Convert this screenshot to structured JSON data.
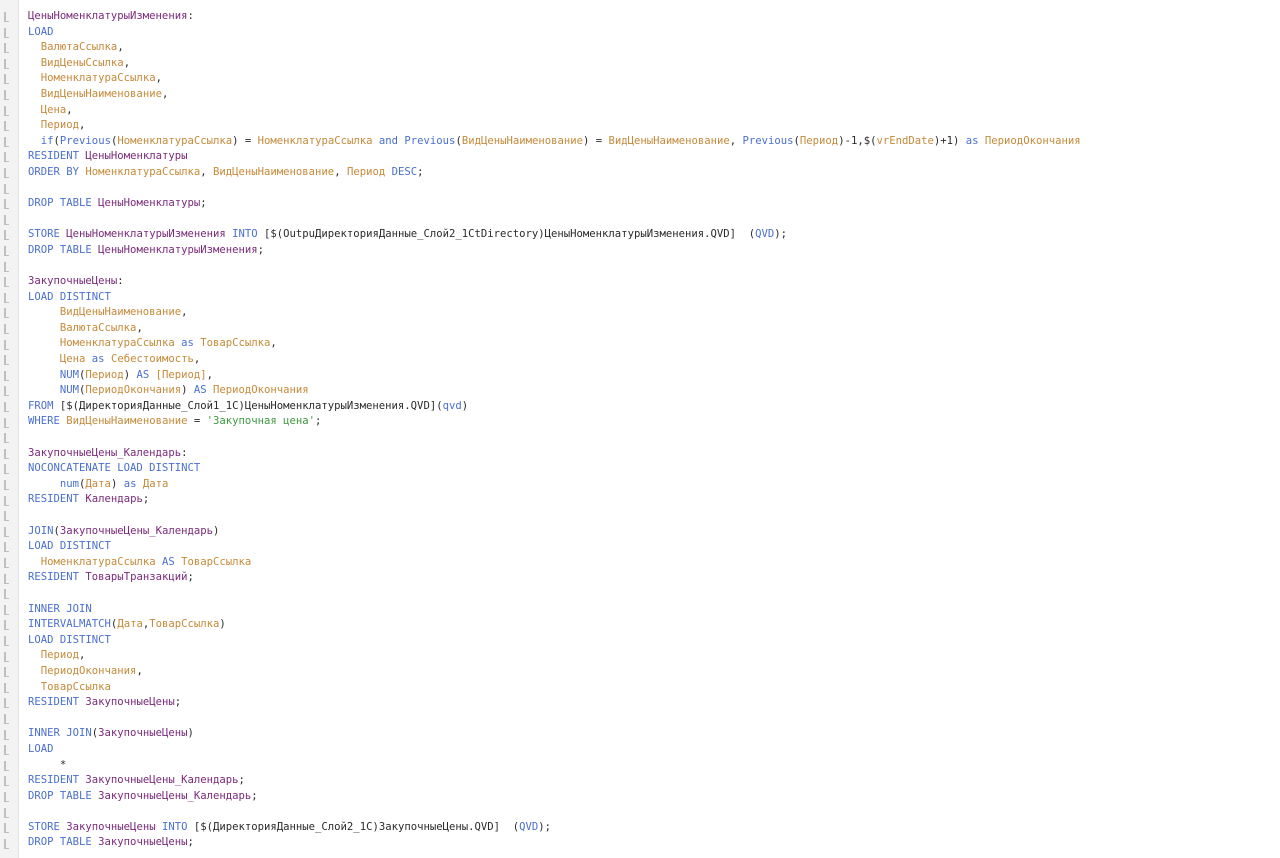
{
  "editor": {
    "lines": [
      [
        {
          "t": "tbl",
          "v": "ЦеныНоменклатурыИзменения"
        },
        {
          "t": "txt",
          "v": ":"
        }
      ],
      [
        {
          "t": "kw",
          "v": "LOAD"
        }
      ],
      [
        {
          "t": "txt",
          "v": "  "
        },
        {
          "t": "fld",
          "v": "ВалютаСсылка"
        },
        {
          "t": "txt",
          "v": ","
        }
      ],
      [
        {
          "t": "txt",
          "v": "  "
        },
        {
          "t": "fld",
          "v": "ВидЦеныСсылка"
        },
        {
          "t": "txt",
          "v": ","
        }
      ],
      [
        {
          "t": "txt",
          "v": "  "
        },
        {
          "t": "fld",
          "v": "НоменклатураСсылка"
        },
        {
          "t": "txt",
          "v": ","
        }
      ],
      [
        {
          "t": "txt",
          "v": "  "
        },
        {
          "t": "fld",
          "v": "ВидЦеныНаименование"
        },
        {
          "t": "txt",
          "v": ","
        }
      ],
      [
        {
          "t": "txt",
          "v": "  "
        },
        {
          "t": "fld",
          "v": "Цена"
        },
        {
          "t": "txt",
          "v": ","
        }
      ],
      [
        {
          "t": "txt",
          "v": "  "
        },
        {
          "t": "fld",
          "v": "Период"
        },
        {
          "t": "txt",
          "v": ","
        }
      ],
      [
        {
          "t": "txt",
          "v": "  "
        },
        {
          "t": "kw",
          "v": "if"
        },
        {
          "t": "txt",
          "v": "("
        },
        {
          "t": "kw",
          "v": "Previous"
        },
        {
          "t": "txt",
          "v": "("
        },
        {
          "t": "fld",
          "v": "НоменклатураСсылка"
        },
        {
          "t": "txt",
          "v": ") = "
        },
        {
          "t": "fld",
          "v": "НоменклатураСсылка"
        },
        {
          "t": "txt",
          "v": " "
        },
        {
          "t": "kw",
          "v": "and"
        },
        {
          "t": "txt",
          "v": " "
        },
        {
          "t": "kw",
          "v": "Previous"
        },
        {
          "t": "txt",
          "v": "("
        },
        {
          "t": "fld",
          "v": "ВидЦеныНаименование"
        },
        {
          "t": "txt",
          "v": ") = "
        },
        {
          "t": "fld",
          "v": "ВидЦеныНаименование"
        },
        {
          "t": "txt",
          "v": ", "
        },
        {
          "t": "kw",
          "v": "Previous"
        },
        {
          "t": "txt",
          "v": "("
        },
        {
          "t": "fld",
          "v": "Период"
        },
        {
          "t": "txt",
          "v": ")-1,$("
        },
        {
          "t": "fld",
          "v": "vrEndDate"
        },
        {
          "t": "txt",
          "v": ")+1) "
        },
        {
          "t": "kw",
          "v": "as"
        },
        {
          "t": "txt",
          "v": " "
        },
        {
          "t": "fld",
          "v": "ПериодОкончания"
        }
      ],
      [
        {
          "t": "kw",
          "v": "RESIDENT"
        },
        {
          "t": "txt",
          "v": " "
        },
        {
          "t": "tbl",
          "v": "ЦеныНоменклатуры"
        }
      ],
      [
        {
          "t": "kw",
          "v": "ORDER BY"
        },
        {
          "t": "txt",
          "v": " "
        },
        {
          "t": "fld",
          "v": "НоменклатураСсылка"
        },
        {
          "t": "txt",
          "v": ", "
        },
        {
          "t": "fld",
          "v": "ВидЦеныНаименование"
        },
        {
          "t": "txt",
          "v": ", "
        },
        {
          "t": "fld",
          "v": "Период"
        },
        {
          "t": "txt",
          "v": " "
        },
        {
          "t": "kw",
          "v": "DESC"
        },
        {
          "t": "txt",
          "v": ";"
        }
      ],
      [],
      [
        {
          "t": "kw",
          "v": "DROP TABLE"
        },
        {
          "t": "txt",
          "v": " "
        },
        {
          "t": "tbl",
          "v": "ЦеныНоменклатуры"
        },
        {
          "t": "txt",
          "v": ";"
        }
      ],
      [],
      [
        {
          "t": "kw",
          "v": "STORE"
        },
        {
          "t": "txt",
          "v": " "
        },
        {
          "t": "tbl",
          "v": "ЦеныНоменклатурыИзменения"
        },
        {
          "t": "txt",
          "v": " "
        },
        {
          "t": "kw",
          "v": "INTO"
        },
        {
          "t": "txt",
          "v": " [$(OutpuДиректорияДанные_Слой2_1CtDirectory)ЦеныНоменклатурыИзменения.QVD]  ("
        },
        {
          "t": "kw",
          "v": "QVD"
        },
        {
          "t": "txt",
          "v": ");"
        }
      ],
      [
        {
          "t": "kw",
          "v": "DROP TABLE"
        },
        {
          "t": "txt",
          "v": " "
        },
        {
          "t": "tbl",
          "v": "ЦеныНоменклатурыИзменения"
        },
        {
          "t": "txt",
          "v": ";"
        }
      ],
      [],
      [
        {
          "t": "tbl",
          "v": "ЗакупочныеЦены"
        },
        {
          "t": "txt",
          "v": ":"
        }
      ],
      [
        {
          "t": "kw",
          "v": "LOAD DISTINCT"
        }
      ],
      [
        {
          "t": "txt",
          "v": "     "
        },
        {
          "t": "fld",
          "v": "ВидЦеныНаименование"
        },
        {
          "t": "txt",
          "v": ","
        }
      ],
      [
        {
          "t": "txt",
          "v": "     "
        },
        {
          "t": "fld",
          "v": "ВалютаСсылка"
        },
        {
          "t": "txt",
          "v": ","
        }
      ],
      [
        {
          "t": "txt",
          "v": "     "
        },
        {
          "t": "fld",
          "v": "НоменклатураСсылка"
        },
        {
          "t": "txt",
          "v": " "
        },
        {
          "t": "kw",
          "v": "as"
        },
        {
          "t": "txt",
          "v": " "
        },
        {
          "t": "fld",
          "v": "ТоварСсылка"
        },
        {
          "t": "txt",
          "v": ","
        }
      ],
      [
        {
          "t": "txt",
          "v": "     "
        },
        {
          "t": "fld",
          "v": "Цена"
        },
        {
          "t": "txt",
          "v": " "
        },
        {
          "t": "kw",
          "v": "as"
        },
        {
          "t": "txt",
          "v": " "
        },
        {
          "t": "fld",
          "v": "Себестоимость"
        },
        {
          "t": "txt",
          "v": ","
        }
      ],
      [
        {
          "t": "txt",
          "v": "     "
        },
        {
          "t": "kw",
          "v": "NUM"
        },
        {
          "t": "txt",
          "v": "("
        },
        {
          "t": "fld",
          "v": "Период"
        },
        {
          "t": "txt",
          "v": ") "
        },
        {
          "t": "kw",
          "v": "AS"
        },
        {
          "t": "txt",
          "v": " "
        },
        {
          "t": "fld",
          "v": "[Период]"
        },
        {
          "t": "txt",
          "v": ","
        }
      ],
      [
        {
          "t": "txt",
          "v": "     "
        },
        {
          "t": "kw",
          "v": "NUM"
        },
        {
          "t": "txt",
          "v": "("
        },
        {
          "t": "fld",
          "v": "ПериодОкончания"
        },
        {
          "t": "txt",
          "v": ") "
        },
        {
          "t": "kw",
          "v": "AS"
        },
        {
          "t": "txt",
          "v": " "
        },
        {
          "t": "fld",
          "v": "ПериодОкончания"
        }
      ],
      [
        {
          "t": "kw",
          "v": "FROM"
        },
        {
          "t": "txt",
          "v": " [$(ДиректорияДанные_Слой1_1C)ЦеныНоменклатурыИзменения.QVD]("
        },
        {
          "t": "kw",
          "v": "qvd"
        },
        {
          "t": "txt",
          "v": ")"
        }
      ],
      [
        {
          "t": "kw",
          "v": "WHERE"
        },
        {
          "t": "txt",
          "v": " "
        },
        {
          "t": "fld",
          "v": "ВидЦеныНаименование"
        },
        {
          "t": "txt",
          "v": " = "
        },
        {
          "t": "str",
          "v": "'Закупочная цена'"
        },
        {
          "t": "txt",
          "v": ";"
        }
      ],
      [],
      [
        {
          "t": "tbl",
          "v": "ЗакупочныеЦены_Календарь"
        },
        {
          "t": "txt",
          "v": ":"
        }
      ],
      [
        {
          "t": "kw",
          "v": "NOCONCATENATE LOAD DISTINCT"
        }
      ],
      [
        {
          "t": "txt",
          "v": "     "
        },
        {
          "t": "kw",
          "v": "num"
        },
        {
          "t": "txt",
          "v": "("
        },
        {
          "t": "fld",
          "v": "Дата"
        },
        {
          "t": "txt",
          "v": ") "
        },
        {
          "t": "kw",
          "v": "as"
        },
        {
          "t": "txt",
          "v": " "
        },
        {
          "t": "fld",
          "v": "Дата"
        }
      ],
      [
        {
          "t": "kw",
          "v": "RESIDENT"
        },
        {
          "t": "txt",
          "v": " "
        },
        {
          "t": "tbl",
          "v": "Календарь"
        },
        {
          "t": "txt",
          "v": ";"
        }
      ],
      [],
      [
        {
          "t": "kw",
          "v": "JOIN"
        },
        {
          "t": "txt",
          "v": "("
        },
        {
          "t": "tbl",
          "v": "ЗакупочныеЦены_Календарь"
        },
        {
          "t": "txt",
          "v": ")"
        }
      ],
      [
        {
          "t": "kw",
          "v": "LOAD DISTINCT"
        }
      ],
      [
        {
          "t": "txt",
          "v": "  "
        },
        {
          "t": "fld",
          "v": "НоменклатураСсылка"
        },
        {
          "t": "txt",
          "v": " "
        },
        {
          "t": "kw",
          "v": "AS"
        },
        {
          "t": "txt",
          "v": " "
        },
        {
          "t": "fld",
          "v": "ТоварСсылка"
        }
      ],
      [
        {
          "t": "kw",
          "v": "RESIDENT"
        },
        {
          "t": "txt",
          "v": " "
        },
        {
          "t": "tbl",
          "v": "ТоварыТранзакций"
        },
        {
          "t": "txt",
          "v": ";"
        }
      ],
      [],
      [
        {
          "t": "kw",
          "v": "INNER JOIN"
        }
      ],
      [
        {
          "t": "kw",
          "v": "INTERVALMATCH"
        },
        {
          "t": "txt",
          "v": "("
        },
        {
          "t": "fld",
          "v": "Дата"
        },
        {
          "t": "txt",
          "v": ","
        },
        {
          "t": "fld",
          "v": "ТоварСсылка"
        },
        {
          "t": "txt",
          "v": ")"
        }
      ],
      [
        {
          "t": "kw",
          "v": "LOAD DISTINCT"
        }
      ],
      [
        {
          "t": "txt",
          "v": "  "
        },
        {
          "t": "fld",
          "v": "Период"
        },
        {
          "t": "txt",
          "v": ","
        }
      ],
      [
        {
          "t": "txt",
          "v": "  "
        },
        {
          "t": "fld",
          "v": "ПериодОкончания"
        },
        {
          "t": "txt",
          "v": ","
        }
      ],
      [
        {
          "t": "txt",
          "v": "  "
        },
        {
          "t": "fld",
          "v": "ТоварСсылка"
        }
      ],
      [
        {
          "t": "kw",
          "v": "RESIDENT"
        },
        {
          "t": "txt",
          "v": " "
        },
        {
          "t": "tbl",
          "v": "ЗакупочныеЦены"
        },
        {
          "t": "txt",
          "v": ";"
        }
      ],
      [],
      [
        {
          "t": "kw",
          "v": "INNER JOIN"
        },
        {
          "t": "txt",
          "v": "("
        },
        {
          "t": "tbl",
          "v": "ЗакупочныеЦены"
        },
        {
          "t": "txt",
          "v": ")"
        }
      ],
      [
        {
          "t": "kw",
          "v": "LOAD"
        }
      ],
      [
        {
          "t": "txt",
          "v": "     *"
        }
      ],
      [
        {
          "t": "kw",
          "v": "RESIDENT"
        },
        {
          "t": "txt",
          "v": " "
        },
        {
          "t": "tbl",
          "v": "ЗакупочныеЦены_Календарь"
        },
        {
          "t": "txt",
          "v": ";"
        }
      ],
      [
        {
          "t": "kw",
          "v": "DROP TABLE"
        },
        {
          "t": "txt",
          "v": " "
        },
        {
          "t": "tbl",
          "v": "ЗакупочныеЦены_Календарь"
        },
        {
          "t": "txt",
          "v": ";"
        }
      ],
      [],
      [
        {
          "t": "kw",
          "v": "STORE"
        },
        {
          "t": "txt",
          "v": " "
        },
        {
          "t": "tbl",
          "v": "ЗакупочныеЦены"
        },
        {
          "t": "txt",
          "v": " "
        },
        {
          "t": "kw",
          "v": "INTO"
        },
        {
          "t": "txt",
          "v": " [$(ДиректорияДанные_Слой2_1C)ЗакупочныеЦены.QVD]  ("
        },
        {
          "t": "kw",
          "v": "QVD"
        },
        {
          "t": "txt",
          "v": ");"
        }
      ],
      [
        {
          "t": "kw",
          "v": "DROP TABLE"
        },
        {
          "t": "txt",
          "v": " "
        },
        {
          "t": "tbl",
          "v": "ЗакупочныеЦены"
        },
        {
          "t": "txt",
          "v": ";"
        }
      ]
    ]
  }
}
